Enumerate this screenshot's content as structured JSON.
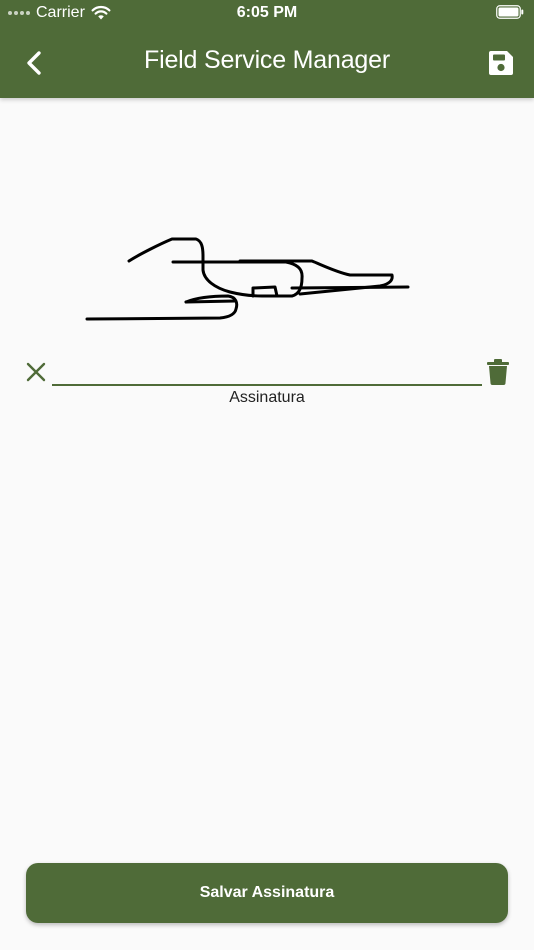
{
  "status_bar": {
    "carrier": "Carrier",
    "time": "6:05 PM"
  },
  "header": {
    "title": "Field Service Manager",
    "back_icon": "chevron-left-icon",
    "save_icon": "floppy-disk-icon"
  },
  "signature": {
    "label": "Assinatura",
    "clear_icon": "close-icon",
    "delete_icon": "trash-icon"
  },
  "actions": {
    "save_signature_label": "Salvar Assinatura"
  },
  "colors": {
    "primary": "#4f6b38",
    "background": "#fafafa",
    "ink": "#000000"
  }
}
